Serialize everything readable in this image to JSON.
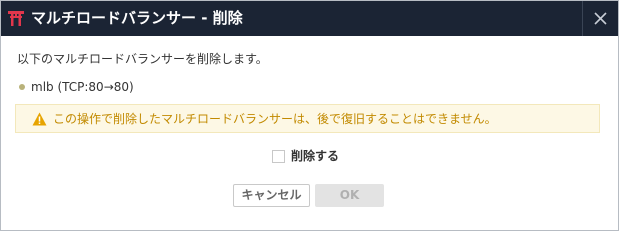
{
  "dialog": {
    "title": "マルチロードバランサー - 削除",
    "title_icon": "torii-icon",
    "close_icon": "close-icon",
    "message": "以下のマルチロードバランサーを削除します。",
    "target": {
      "name": "mlb (TCP:80→80)"
    },
    "warning": {
      "icon": "warning-icon",
      "text": "この操作で削除したマルチロードバランサーは、後で復旧することはできません。"
    },
    "confirm": {
      "label": "削除する",
      "checked": false
    },
    "buttons": {
      "cancel": "キャンセル",
      "ok": "OK",
      "ok_enabled": false
    }
  },
  "colors": {
    "titlebar": "#1b2434",
    "brand_icon": "#e2364c",
    "warning_text": "#c28a00",
    "warning_bg": "#fdf8e5",
    "warning_icon": "#e7a400"
  }
}
